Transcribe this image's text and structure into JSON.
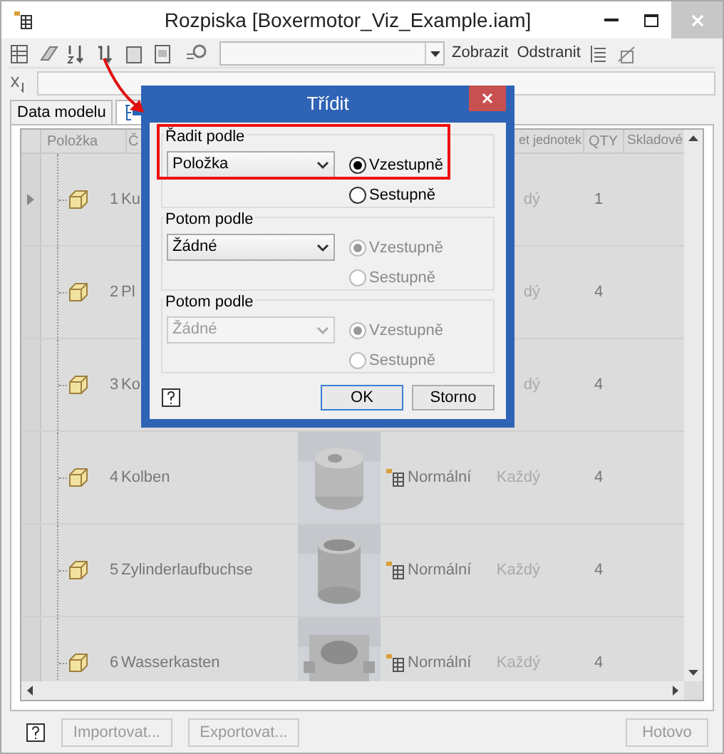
{
  "window": {
    "title": "Rozpiska [Boxermotor_Viz_Example.iam]"
  },
  "toolbar": {
    "text_buttons": [
      "Zobrazit",
      "Odstranit"
    ]
  },
  "tabs": [
    {
      "label": "Data modelu",
      "selected": false
    },
    {
      "selected": true
    }
  ],
  "table": {
    "columns": [
      "Položka",
      "Č",
      "et jednotek",
      "QTY",
      "Skladové"
    ],
    "rows": [
      {
        "number": "1",
        "name": "Ku",
        "unit": "dý",
        "qty": "1",
        "current": true
      },
      {
        "number": "2",
        "name": "Pl",
        "unit": "dý",
        "qty": "4",
        "current": false
      },
      {
        "number": "3",
        "name": "Ko",
        "unit": "dý",
        "qty": "4",
        "current": false
      },
      {
        "number": "4",
        "name": "Kolben",
        "structure": "Normální",
        "unit": "Každý",
        "qty": "4",
        "current": false
      },
      {
        "number": "5",
        "name": "Zylinderlaufbuchse",
        "structure": "Normální",
        "unit": "Každý",
        "qty": "4",
        "current": false
      },
      {
        "number": "6",
        "name": "Wasserkasten",
        "structure": "Normální",
        "unit": "Každý",
        "qty": "4",
        "current": false
      }
    ]
  },
  "footer": {
    "buttons": [
      {
        "label": "Importovat...",
        "disabled": true
      },
      {
        "label": "Exportovat...",
        "disabled": true
      }
    ],
    "done": {
      "label": "Hotovo",
      "disabled": true
    }
  },
  "dialog": {
    "title": "Třídit",
    "groups": [
      {
        "label": "Řadit podle",
        "value": "Položka",
        "disabled": false,
        "highlighted": true,
        "options": [
          {
            "label": "Vzestupně",
            "selected": true,
            "disabled": false
          },
          {
            "label": "Sestupně",
            "selected": false,
            "disabled": false
          }
        ]
      },
      {
        "label": "Potom podle",
        "value": "Žádné",
        "disabled": false,
        "options": [
          {
            "label": "Vzestupně",
            "selected": true,
            "disabled": true
          },
          {
            "label": "Sestupně",
            "selected": false,
            "disabled": true
          }
        ]
      },
      {
        "label": "Potom podle",
        "value": "Žádné",
        "disabled": true,
        "options": [
          {
            "label": "Vzestupně",
            "selected": true,
            "disabled": true
          },
          {
            "label": "Sestupně",
            "selected": false,
            "disabled": true
          }
        ]
      }
    ],
    "buttons": [
      {
        "label": "OK",
        "default": true
      },
      {
        "label": "Storno",
        "default": false
      }
    ]
  }
}
